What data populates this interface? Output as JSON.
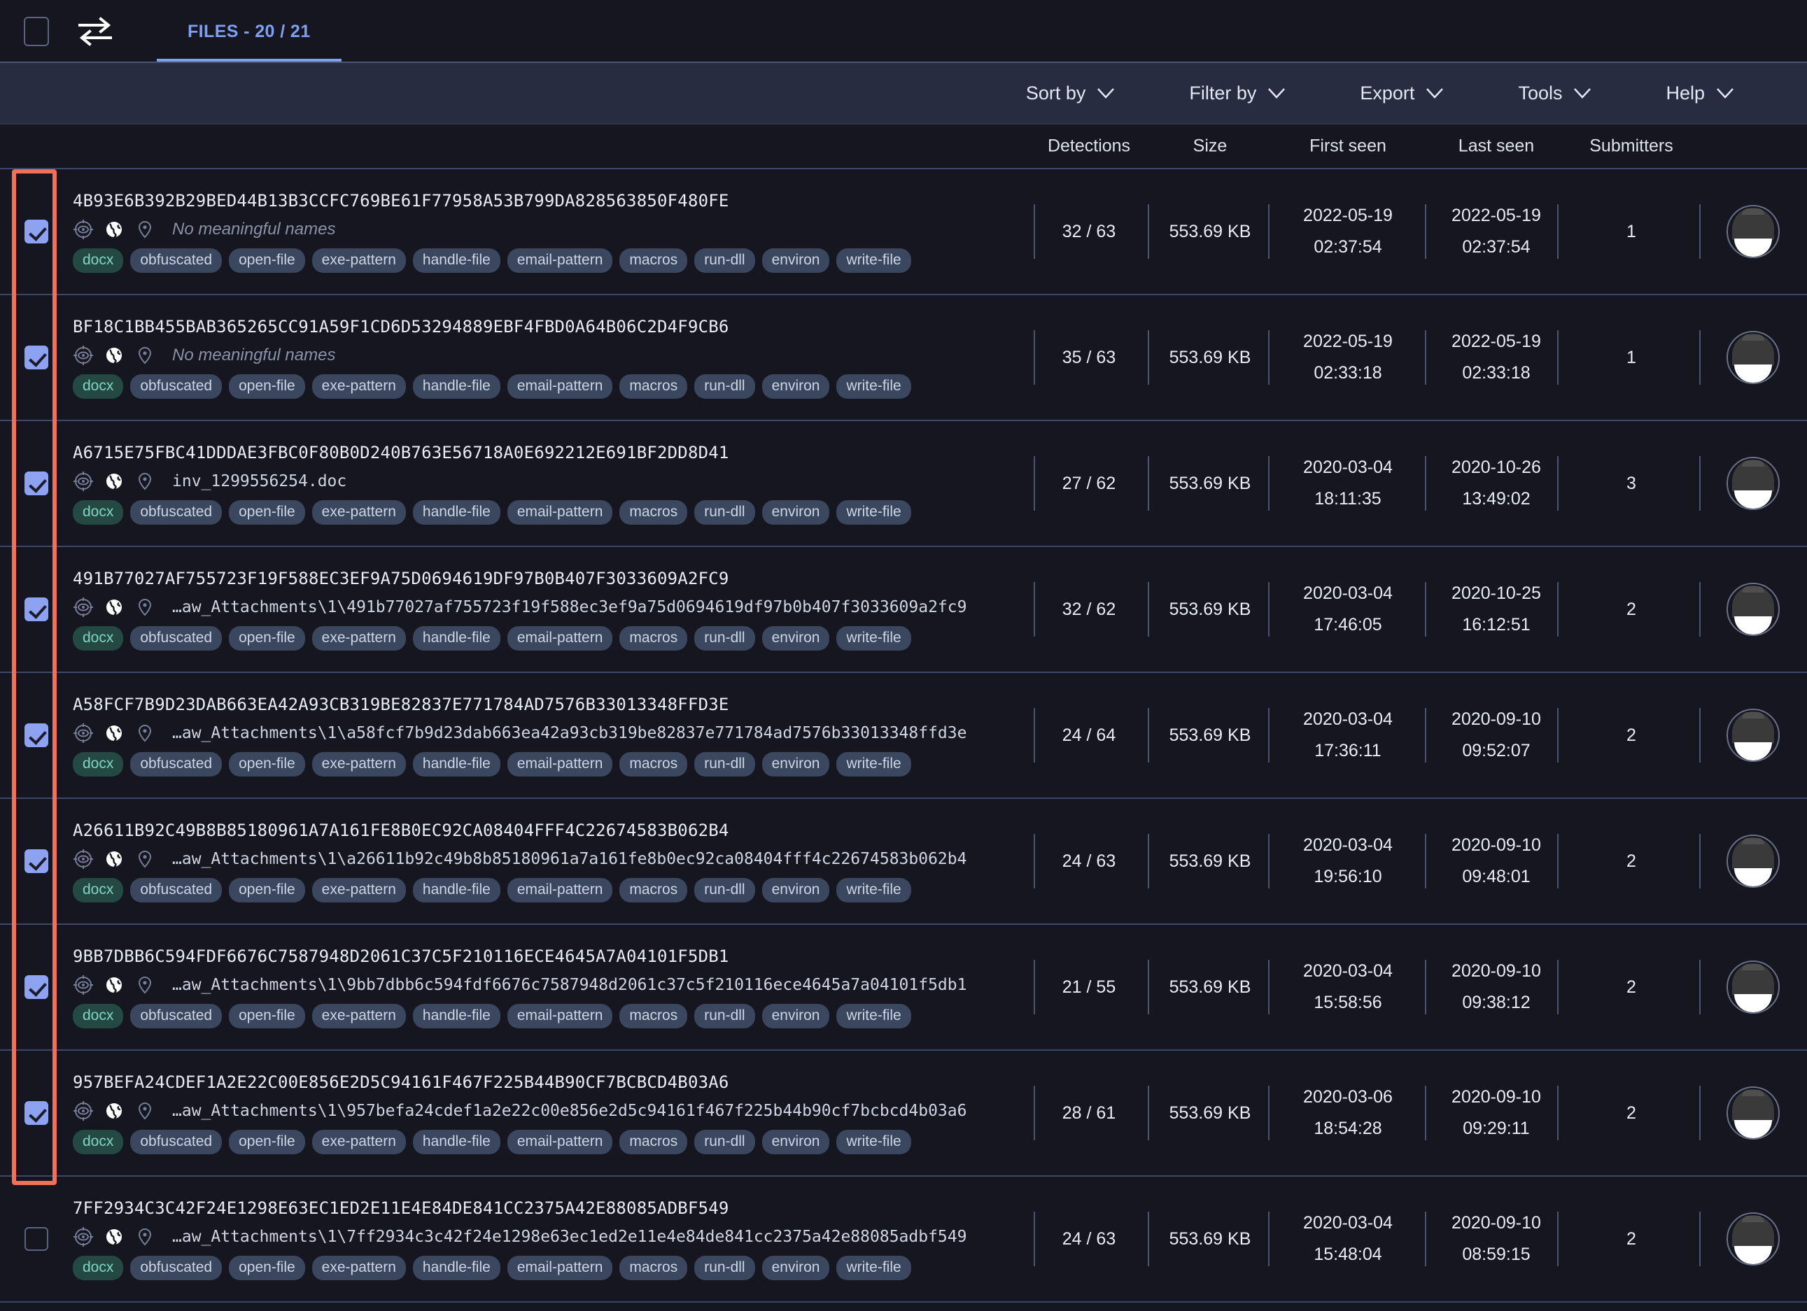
{
  "topbar": {
    "select_all_checkbox": "",
    "swap_icon": "swap-arrows-icon",
    "tab_label": "FILES - 20 / 21"
  },
  "menubar": {
    "items": [
      {
        "label": "Sort by",
        "icon": "chevron-down-icon"
      },
      {
        "label": "Filter by",
        "icon": "chevron-down-icon"
      },
      {
        "label": "Export",
        "icon": "chevron-down-icon"
      },
      {
        "label": "Tools",
        "icon": "chevron-down-icon"
      },
      {
        "label": "Help",
        "icon": "chevron-down-icon"
      }
    ]
  },
  "columns": {
    "detections": "Detections",
    "size": "Size",
    "first_seen": "First seen",
    "last_seen": "Last seen",
    "submitters": "Submitters"
  },
  "colors": {
    "page_bg": "#15161f",
    "menubar_bg": "#272c40",
    "accent_tab": "#7f9ff0",
    "checkbox_checked": "#8da2f0",
    "selection_outline": "#f0705a",
    "tag_bg": "#3b475e",
    "filetype_tag_bg": "#244942",
    "filetype_tag_text": "#7fd6c0",
    "divider": "#3e476a"
  },
  "common_tags": [
    "obfuscated",
    "open-file",
    "exe-pattern",
    "handle-file",
    "email-pattern",
    "macros",
    "run-dll",
    "environ",
    "write-file"
  ],
  "filetype_tag": "docx",
  "row_icons": [
    "crosshair-icon",
    "globe-icon",
    "location-pin-icon"
  ],
  "rows": [
    {
      "checked": true,
      "hash": "4B93E6B392B29BED44B13B3CCFC769BE61F77958A53B799DA828563850F480FE",
      "name": "No meaningful names",
      "name_is_placeholder": true,
      "filetype": "docx",
      "tags": [
        "obfuscated",
        "open-file",
        "exe-pattern",
        "handle-file",
        "email-pattern",
        "macros",
        "run-dll",
        "environ",
        "write-file"
      ],
      "detections": "32 / 63",
      "size": "553.69 KB",
      "first_seen_date": "2022-05-19",
      "first_seen_time": "02:37:54",
      "last_seen_date": "2022-05-19",
      "last_seen_time": "02:37:54",
      "submitters": "1"
    },
    {
      "checked": true,
      "hash": "BF18C1BB455BAB365265CC91A59F1CD6D53294889EBF4FBD0A64B06C2D4F9CB6",
      "name": "No meaningful names",
      "name_is_placeholder": true,
      "filetype": "docx",
      "tags": [
        "obfuscated",
        "open-file",
        "exe-pattern",
        "handle-file",
        "email-pattern",
        "macros",
        "run-dll",
        "environ",
        "write-file"
      ],
      "detections": "35 / 63",
      "size": "553.69 KB",
      "first_seen_date": "2022-05-19",
      "first_seen_time": "02:33:18",
      "last_seen_date": "2022-05-19",
      "last_seen_time": "02:33:18",
      "submitters": "1"
    },
    {
      "checked": true,
      "hash": "A6715E75FBC41DDDAE3FBC0F80B0D240B763E56718A0E692212E691BF2DD8D41",
      "name": "inv_1299556254.doc",
      "name_is_placeholder": false,
      "filetype": "docx",
      "tags": [
        "obfuscated",
        "open-file",
        "exe-pattern",
        "handle-file",
        "email-pattern",
        "macros",
        "run-dll",
        "environ",
        "write-file"
      ],
      "detections": "27 / 62",
      "size": "553.69 KB",
      "first_seen_date": "2020-03-04",
      "first_seen_time": "18:11:35",
      "last_seen_date": "2020-10-26",
      "last_seen_time": "13:49:02",
      "submitters": "3"
    },
    {
      "checked": true,
      "hash": "491B77027AF755723F19F588EC3EF9A75D0694619DF97B0B407F3033609A2FC9",
      "name": "…aw_Attachments\\1\\491b77027af755723f19f588ec3ef9a75d0694619df97b0b407f3033609a2fc9",
      "name_is_placeholder": false,
      "filetype": "docx",
      "tags": [
        "obfuscated",
        "open-file",
        "exe-pattern",
        "handle-file",
        "email-pattern",
        "macros",
        "run-dll",
        "environ",
        "write-file"
      ],
      "detections": "32 / 62",
      "size": "553.69 KB",
      "first_seen_date": "2020-03-04",
      "first_seen_time": "17:46:05",
      "last_seen_date": "2020-10-25",
      "last_seen_time": "16:12:51",
      "submitters": "2"
    },
    {
      "checked": true,
      "hash": "A58FCF7B9D23DAB663EA42A93CB319BE82837E771784AD7576B33013348FFD3E",
      "name": "…aw_Attachments\\1\\a58fcf7b9d23dab663ea42a93cb319be82837e771784ad7576b33013348ffd3e",
      "name_is_placeholder": false,
      "filetype": "docx",
      "tags": [
        "obfuscated",
        "open-file",
        "exe-pattern",
        "handle-file",
        "email-pattern",
        "macros",
        "run-dll",
        "environ",
        "write-file"
      ],
      "detections": "24 / 64",
      "size": "553.69 KB",
      "first_seen_date": "2020-03-04",
      "first_seen_time": "17:36:11",
      "last_seen_date": "2020-09-10",
      "last_seen_time": "09:52:07",
      "submitters": "2"
    },
    {
      "checked": true,
      "hash": "A26611B92C49B8B85180961A7A161FE8B0EC92CA08404FFF4C22674583B062B4",
      "name": "…aw_Attachments\\1\\a26611b92c49b8b85180961a7a161fe8b0ec92ca08404fff4c22674583b062b4",
      "name_is_placeholder": false,
      "filetype": "docx",
      "tags": [
        "obfuscated",
        "open-file",
        "exe-pattern",
        "handle-file",
        "email-pattern",
        "macros",
        "run-dll",
        "environ",
        "write-file"
      ],
      "detections": "24 / 63",
      "size": "553.69 KB",
      "first_seen_date": "2020-03-04",
      "first_seen_time": "19:56:10",
      "last_seen_date": "2020-09-10",
      "last_seen_time": "09:48:01",
      "submitters": "2"
    },
    {
      "checked": true,
      "hash": "9BB7DBB6C594FDF6676C7587948D2061C37C5F210116ECE4645A7A04101F5DB1",
      "name": "…aw_Attachments\\1\\9bb7dbb6c594fdf6676c7587948d2061c37c5f210116ece4645a7a04101f5db1",
      "name_is_placeholder": false,
      "filetype": "docx",
      "tags": [
        "obfuscated",
        "open-file",
        "exe-pattern",
        "handle-file",
        "email-pattern",
        "macros",
        "run-dll",
        "environ",
        "write-file"
      ],
      "detections": "21 / 55",
      "size": "553.69 KB",
      "first_seen_date": "2020-03-04",
      "first_seen_time": "15:58:56",
      "last_seen_date": "2020-09-10",
      "last_seen_time": "09:38:12",
      "submitters": "2"
    },
    {
      "checked": true,
      "hash": "957BEFA24CDEF1A2E22C00E856E2D5C94161F467F225B44B90CF7BCBCD4B03A6",
      "name": "…aw_Attachments\\1\\957befa24cdef1a2e22c00e856e2d5c94161f467f225b44b90cf7bcbcd4b03a6",
      "name_is_placeholder": false,
      "filetype": "docx",
      "tags": [
        "obfuscated",
        "open-file",
        "exe-pattern",
        "handle-file",
        "email-pattern",
        "macros",
        "run-dll",
        "environ",
        "write-file"
      ],
      "detections": "28 / 61",
      "size": "553.69 KB",
      "first_seen_date": "2020-03-06",
      "first_seen_time": "18:54:28",
      "last_seen_date": "2020-09-10",
      "last_seen_time": "09:29:11",
      "submitters": "2"
    },
    {
      "checked": false,
      "hash": "7FF2934C3C42F24E1298E63EC1ED2E11E4E84DE841CC2375A42E88085ADBF549",
      "name": "…aw_Attachments\\1\\7ff2934c3c42f24e1298e63ec1ed2e11e4e84de841cc2375a42e88085adbf549",
      "name_is_placeholder": false,
      "filetype": "docx",
      "tags": [
        "obfuscated",
        "open-file",
        "exe-pattern",
        "handle-file",
        "email-pattern",
        "macros",
        "run-dll",
        "environ",
        "write-file"
      ],
      "detections": "24 / 63",
      "size": "553.69 KB",
      "first_seen_date": "2020-03-04",
      "first_seen_time": "15:48:04",
      "last_seen_date": "2020-09-10",
      "last_seen_time": "08:59:15",
      "submitters": "2"
    }
  ]
}
